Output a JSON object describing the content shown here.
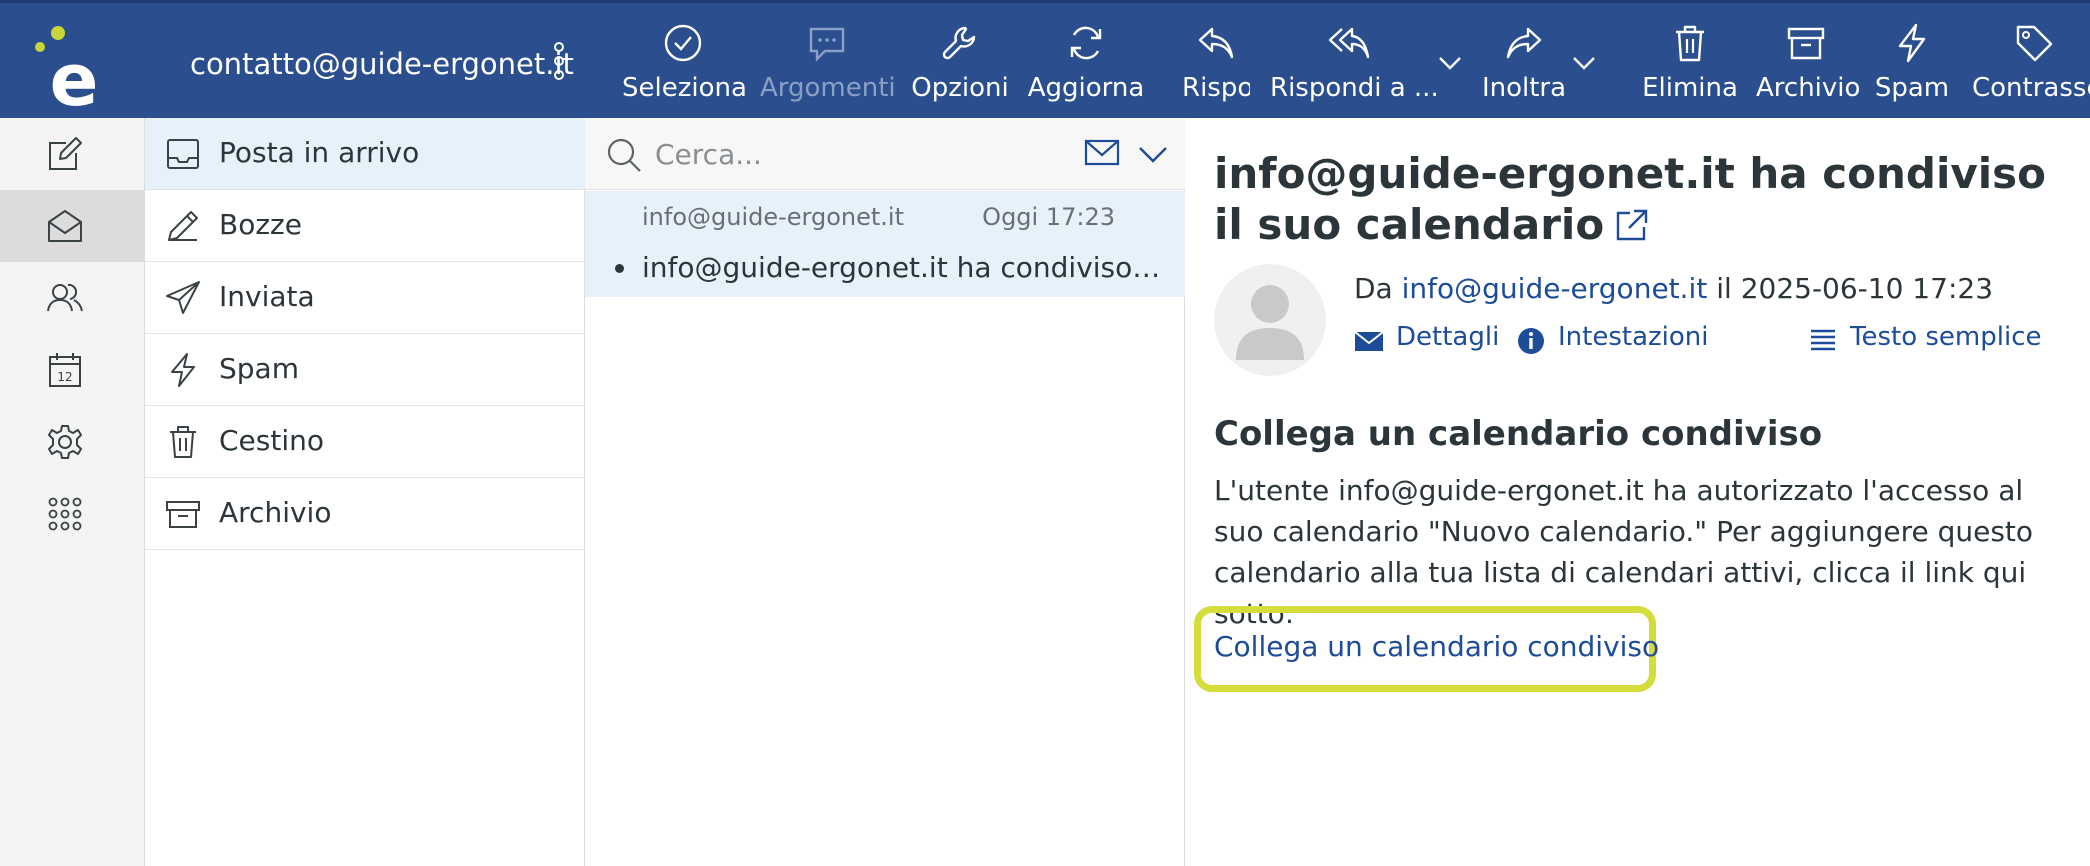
{
  "app": {
    "account": "contatto@guide-ergonet.it",
    "brand_color": "#2a4e8e",
    "accent_color": "#d4dd3c"
  },
  "toolbar": {
    "seleziona": "Seleziona",
    "argomenti": "Argomenti",
    "opzioni": "Opzioni",
    "aggiorna": "Aggiorna",
    "rispondi": "Rispondi",
    "rispondi_a": "Rispondi a ...",
    "inoltra": "Inoltra",
    "elimina": "Elimina",
    "archivio": "Archivio",
    "spam": "Spam",
    "contrassegna": "Contrassegna"
  },
  "nav": {
    "items": [
      {
        "icon": "compose-icon"
      },
      {
        "icon": "mail-icon",
        "active": true
      },
      {
        "icon": "contacts-icon"
      },
      {
        "icon": "calendar-icon",
        "day": "12"
      },
      {
        "icon": "settings-icon"
      },
      {
        "icon": "apps-grid-icon"
      }
    ]
  },
  "folders": {
    "items": [
      {
        "label": "Posta in arrivo",
        "icon": "inbox-icon"
      },
      {
        "label": "Bozze",
        "icon": "pencil-icon"
      },
      {
        "label": "Inviata",
        "icon": "send-icon"
      },
      {
        "label": "Spam",
        "icon": "lightning-icon"
      },
      {
        "label": "Cestino",
        "icon": "trash-icon"
      },
      {
        "label": "Archivio",
        "icon": "archive-icon"
      }
    ]
  },
  "search": {
    "placeholder": "Cerca..."
  },
  "messages": [
    {
      "from": "info@guide-ergonet.it",
      "date": "Oggi 17:23",
      "subject": "info@guide-ergonet.it ha condiviso il suo calendario"
    }
  ],
  "preview": {
    "title": "info@guide-ergonet.it ha condiviso il suo calendario",
    "from_prefix": "Da",
    "from": "info@guide-ergonet.it",
    "date_prefix": "il",
    "date": "2025-06-10 17:23",
    "links": {
      "details": "Dettagli",
      "headers": "Intestazioni",
      "plain_text": "Testo semplice"
    },
    "body_heading": "Collega un calendario condiviso",
    "body_text": "L'utente info@guide-ergonet.it ha autorizzato l'accesso al suo calendario \"Nuovo calendario.\" Per aggiungere questo calendario alla tua lista di calendari attivi, clicca il link qui sotto:",
    "cta": "Collega un calendario condiviso"
  }
}
